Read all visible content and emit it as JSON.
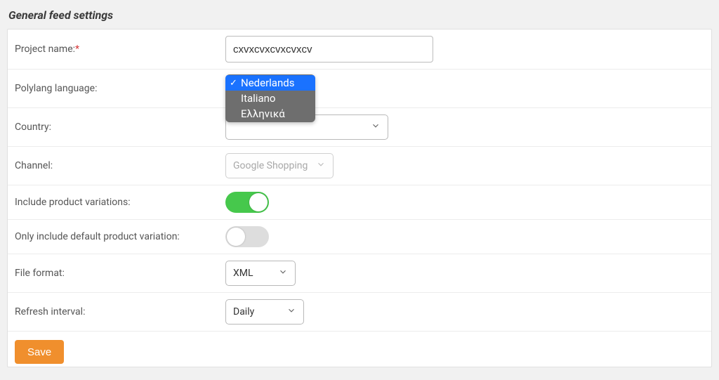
{
  "section_title": "General feed settings",
  "labels": {
    "project_name": "Project name:",
    "polylang": "Polylang language:",
    "country": "Country:",
    "channel": "Channel:",
    "include_variations": "Include product variations:",
    "only_default_variation": "Only include default product variation:",
    "file_format": "File format:",
    "refresh_interval": "Refresh interval:"
  },
  "values": {
    "project_name": "cxvxcvxcvxcvxcv",
    "country": "",
    "channel": "Google Shopping",
    "file_format": "XML",
    "refresh_interval": "Daily"
  },
  "polylang_dropdown": {
    "opt1": "Nederlands",
    "opt2": "Italiano",
    "opt3": "Ελληνικά"
  },
  "buttons": {
    "save": "Save"
  }
}
